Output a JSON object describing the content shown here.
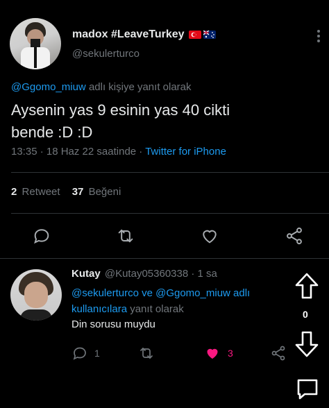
{
  "main_tweet": {
    "display_name": "madox #LeaveTurkey",
    "flags": [
      "turkey-flag",
      "australia-flag"
    ],
    "handle": "@sekulerturco",
    "reply_to_user": "@Ggomo_miuw",
    "reply_suffix": "adlı kişiye yanıt olarak",
    "text_line1": "Aysenin yas 9 esinin yas 40 cikti",
    "text_line2": "bende :D :D",
    "time": "13:35 · 18 Haz 22 saatinde ·",
    "source": "Twitter for iPhone",
    "retweet_count": "2",
    "retweet_label": "Retweet",
    "like_count": "37",
    "like_label": "Beğeni"
  },
  "reply_tweet": {
    "display_name": "Kutay",
    "handle_time": "@Kutay05360338 · 1 sa",
    "reply_line1_users": "@sekulerturco ve @Ggomo_miuw adlı",
    "reply_line2_users": "kullanıcılara",
    "reply_line2_suffix": "yanıt olarak",
    "text": "Din sorusu muydu",
    "reply_count": "1",
    "like_count": "3"
  },
  "vote_panel": {
    "score": "0"
  },
  "colors": {
    "background": "#000000",
    "text": "#e7e9ea",
    "muted": "#71767b",
    "link": "#1d9bf0",
    "like": "#f91880",
    "divider": "#2f3336"
  },
  "icons": [
    "more-vert-icon",
    "comment-icon",
    "retweet-icon",
    "heart-icon",
    "share-icon",
    "up-arrow-icon",
    "down-arrow-icon",
    "chat-bubble-icon"
  ]
}
